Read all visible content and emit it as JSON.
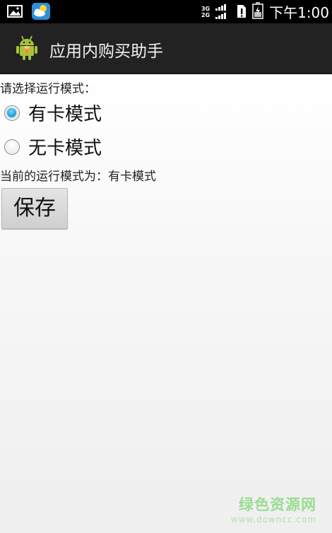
{
  "status_bar": {
    "network_labels": [
      "3G",
      "2G"
    ],
    "time": "下午1:00",
    "icons": [
      "gallery-icon",
      "weather-app-icon",
      "signal-icon",
      "sim-alert-icon",
      "battery-icon"
    ]
  },
  "action_bar": {
    "title": "应用内购买助手",
    "app_icon": "android-robot-icon"
  },
  "form": {
    "prompt": "请选择运行模式：",
    "options": [
      {
        "label": "有卡模式",
        "checked": true
      },
      {
        "label": "无卡模式",
        "checked": false
      }
    ],
    "current_mode_text": "当前的运行模式为：有卡模式",
    "save_label": "保存"
  },
  "watermark": {
    "main": "绿色资源网",
    "sub": "www.downcc.com"
  },
  "colors": {
    "status_bar": "#000000",
    "action_bar": "#222222",
    "accent": "#33b5e5",
    "watermark": "#9bdc93"
  }
}
